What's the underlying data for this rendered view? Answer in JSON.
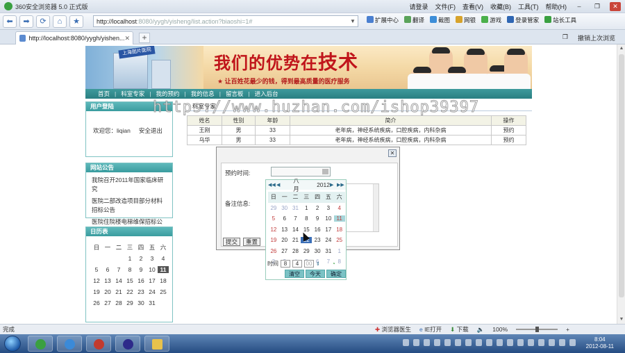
{
  "browser": {
    "title": "360安全浏览器 5.0 正式版",
    "titlebar_items": [
      "请登录",
      "文件(F)",
      "查看(V)",
      "收藏(B)",
      "工具(T)",
      "帮助(H)"
    ],
    "address_host": "http://localhost",
    "address_rest": ":8080/yygh/yisheng/list.action?biaoshi=1#",
    "toolbar_items": [
      "扩展中心",
      "翻译",
      "截图",
      "网银",
      "游戏",
      "登录管家",
      "站长工具"
    ],
    "tab_title": "http://localhost:8080/yygh/yishen...",
    "tab_right": [
      "撤销上次浏览"
    ]
  },
  "site": {
    "banner_slogan_a": "我们的优势在",
    "banner_slogan_b": "技术",
    "banner_sub": "让百姓花最少的钱，得到最高质量的医疗服务",
    "hospital_sign": "上海图片医院",
    "menu": [
      "首页",
      "科室专家",
      "我的预约",
      "我的信息",
      "留言板",
      "进入后台"
    ],
    "login": {
      "title": "用户登陆",
      "welcome": "欢迎您：liqian",
      "logout": "安全退出"
    },
    "notice": {
      "title": "网站公告",
      "items": [
        "我院召开2011年国家临床研究",
        "医院二部改造项目部分材料招标公告",
        "医院住院楼电梯维保招标公告"
      ]
    },
    "calendar": {
      "title": "日历表",
      "weekdays": [
        "日",
        "一",
        "二",
        "三",
        "四",
        "五",
        "六"
      ],
      "rows": [
        [
          "",
          "",
          "",
          "1",
          "2",
          "3",
          "4"
        ],
        [
          "5",
          "6",
          "7",
          "8",
          "9",
          "10",
          "11"
        ],
        [
          "12",
          "13",
          "14",
          "15",
          "16",
          "17",
          "18"
        ],
        [
          "19",
          "20",
          "21",
          "22",
          "23",
          "24",
          "25"
        ],
        [
          "26",
          "27",
          "28",
          "29",
          "30",
          "31",
          ""
        ]
      ],
      "today": "11"
    },
    "main": {
      "title": "科室专家",
      "headers": [
        "姓名",
        "性别",
        "年龄",
        "简介",
        "操作"
      ],
      "rows": [
        {
          "name": "王刚",
          "gender": "男",
          "age": "33",
          "intro": "老年病，神经系统疾病，口腔疾病，内科杂病",
          "op": "预约"
        },
        {
          "name": "乌华",
          "gender": "男",
          "age": "33",
          "intro": "老年病，神经系统疾病，口腔疾病，内科杂病",
          "op": "预约"
        }
      ]
    }
  },
  "modal": {
    "close": "✕",
    "time_label": "预约时间:",
    "notes_label": "备注信息:",
    "submit": "提交",
    "reset": "重置"
  },
  "datepicker": {
    "month": "八月",
    "year": "2012",
    "weekdays": [
      "日",
      "一",
      "二",
      "三",
      "四",
      "五",
      "六"
    ],
    "rows": [
      [
        "29",
        "30",
        "31",
        "1",
        "2",
        "3",
        "4"
      ],
      [
        "5",
        "6",
        "7",
        "8",
        "9",
        "10",
        "11"
      ],
      [
        "12",
        "13",
        "14",
        "15",
        "16",
        "17",
        "18"
      ],
      [
        "19",
        "20",
        "21",
        "22",
        "23",
        "24",
        "25"
      ],
      [
        "26",
        "27",
        "28",
        "29",
        "30",
        "31",
        "1"
      ],
      [
        "2",
        "3",
        "4",
        "5",
        "6",
        "7",
        "8"
      ]
    ],
    "time_label": "时间",
    "hour": "8",
    "minute": "4",
    "second": "00",
    "buttons": [
      "清空",
      "今天",
      "确定"
    ]
  },
  "watermark": "https://www.huzhan.com/ishop39397",
  "statusbar": {
    "left": "完成",
    "items": [
      "浏览器医生",
      "IE打开",
      "下载",
      "100%"
    ]
  },
  "taskbar": {
    "time": "8:04",
    "date": "2012-08-11"
  }
}
